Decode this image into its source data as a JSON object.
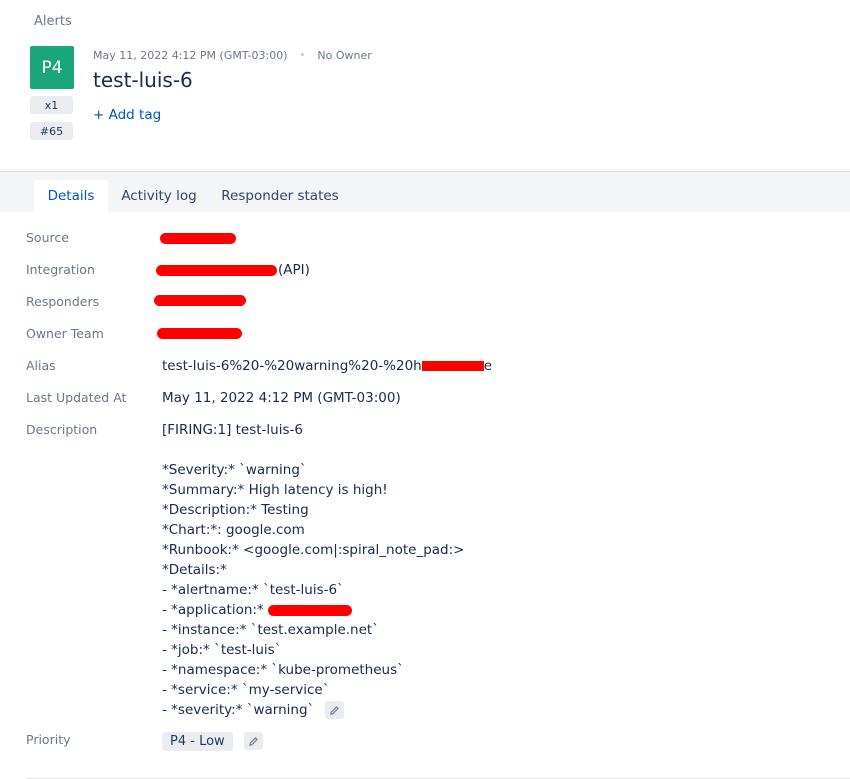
{
  "header": {
    "breadcrumb": "Alerts",
    "priority_badge": "P4",
    "count_chip": "x1",
    "tiny_id": "#65",
    "timestamp": "May 11, 2022 4:12 PM (GMT-03:00)",
    "owner": "No Owner",
    "title": "test-luis-6",
    "add_tag": "+ Add tag"
  },
  "tabs": [
    {
      "label": "Details",
      "active": true
    },
    {
      "label": "Activity log",
      "active": false
    },
    {
      "label": "Responder states",
      "active": false
    }
  ],
  "fields": {
    "source_label": "Source",
    "integration_label": "Integration",
    "integration_suffix": "(API)",
    "responders_label": "Responders",
    "owner_team_label": "Owner Team",
    "alias_label": "Alias",
    "alias_value_start": "test-luis-6%20-%20warning%20-%20h",
    "alias_value_end": "e",
    "last_updated_label": "Last Updated At",
    "last_updated_value": "May 11, 2022 4:12 PM (GMT-03:00)",
    "description_label": "Description",
    "priority_label": "Priority",
    "priority_value": "P4 - Low"
  },
  "description_lines": [
    "[FIRING:1] test-luis-6",
    "",
    "*Severity:* `warning`",
    "*Summary:* High latency is high!",
    "*Description:* Testing",
    "*Chart:*: google.com",
    "*Runbook:* <google.com|:spiral_note_pad:>",
    "*Details:*",
    "- *alertname:* `test-luis-6`",
    "- *application:* ",
    "- *instance:* `test.example.net`",
    "- *job:* `test-luis`",
    "- *namespace:* `kube-prometheus`",
    "- *service:* `my-service`",
    "- *severity:* `warning`"
  ],
  "colors": {
    "priority_badge": "#1aa67a",
    "link": "#0052cc",
    "redaction": "#ff0000"
  },
  "icons": {
    "edit": "pencil-icon"
  }
}
